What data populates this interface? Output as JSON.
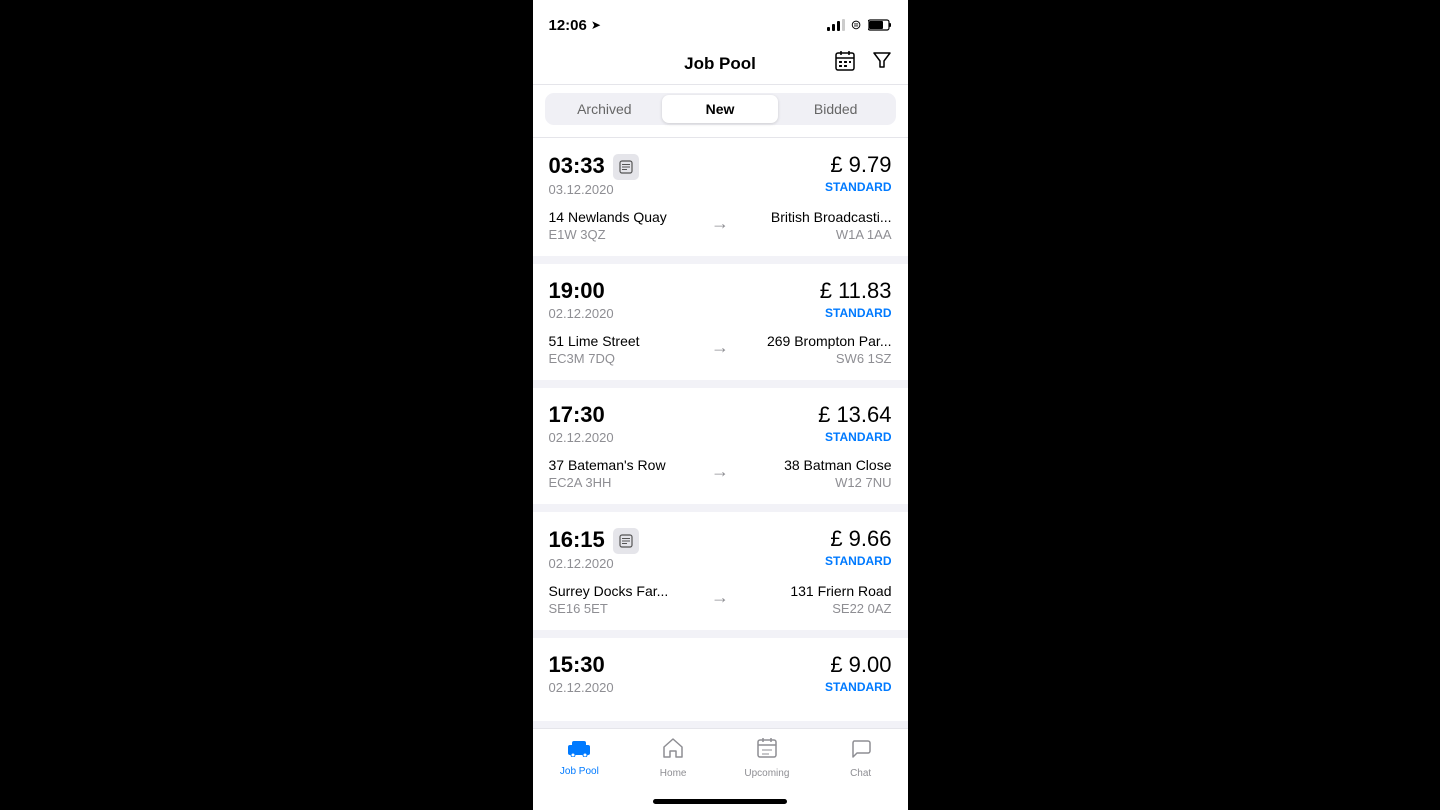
{
  "statusBar": {
    "time": "12:06",
    "locationIcon": "➤"
  },
  "header": {
    "title": "Job Pool",
    "calendarIcon": "📅",
    "filterIcon": "⛛"
  },
  "tabs": [
    {
      "id": "archived",
      "label": "Archived",
      "active": false
    },
    {
      "id": "new",
      "label": "New",
      "active": true
    },
    {
      "id": "bidded",
      "label": "Bidded",
      "active": false
    }
  ],
  "jobs": [
    {
      "id": 1,
      "time": "03:33",
      "date": "03.12.2020",
      "hasNote": true,
      "price": "£ 9.79",
      "type": "STANDARD",
      "fromAddress": "14 Newlands Quay",
      "fromPostcode": "E1W 3QZ",
      "toAddress": "British Broadcasti...",
      "toPostcode": "W1A 1AA"
    },
    {
      "id": 2,
      "time": "19:00",
      "date": "02.12.2020",
      "hasNote": false,
      "price": "£ 11.83",
      "type": "STANDARD",
      "fromAddress": "51 Lime Street",
      "fromPostcode": "EC3M 7DQ",
      "toAddress": "269 Brompton Par...",
      "toPostcode": "SW6 1SZ"
    },
    {
      "id": 3,
      "time": "17:30",
      "date": "02.12.2020",
      "hasNote": false,
      "price": "£ 13.64",
      "type": "STANDARD",
      "fromAddress": "37 Bateman's Row",
      "fromPostcode": "EC2A 3HH",
      "toAddress": "38 Batman Close",
      "toPostcode": "W12 7NU"
    },
    {
      "id": 4,
      "time": "16:15",
      "date": "02.12.2020",
      "hasNote": true,
      "price": "£ 9.66",
      "type": "STANDARD",
      "fromAddress": "Surrey Docks Far...",
      "fromPostcode": "SE16 5ET",
      "toAddress": "131 Friern Road",
      "toPostcode": "SE22 0AZ"
    },
    {
      "id": 5,
      "time": "15:30",
      "date": "02.12.2020",
      "hasNote": false,
      "price": "£ 9.00",
      "type": "STANDARD",
      "fromAddress": "...",
      "fromPostcode": "",
      "toAddress": "...",
      "toPostcode": ""
    }
  ],
  "bottomNav": [
    {
      "id": "job-pool",
      "label": "Job Pool",
      "icon": "🚗",
      "active": true
    },
    {
      "id": "home",
      "label": "Home",
      "icon": "🏠",
      "active": false
    },
    {
      "id": "upcoming",
      "label": "Upcoming",
      "icon": "📋",
      "active": false
    },
    {
      "id": "chat",
      "label": "Chat",
      "icon": "💬",
      "active": false
    }
  ]
}
